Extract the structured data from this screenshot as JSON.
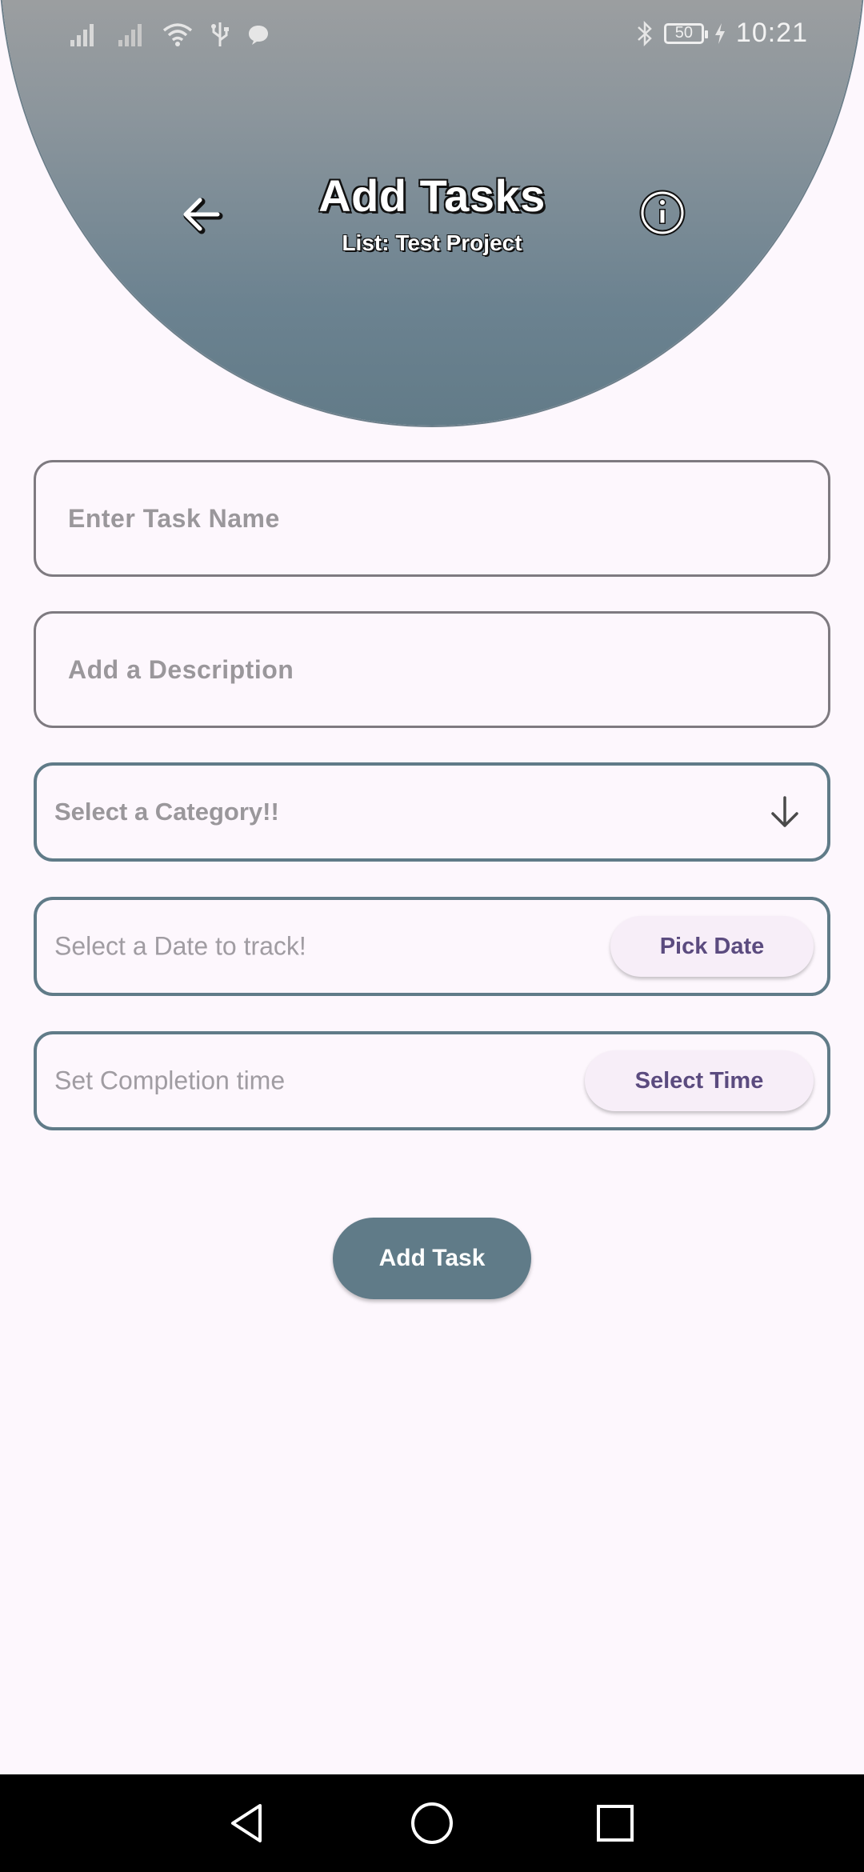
{
  "status_bar": {
    "time": "10:21",
    "battery": "50"
  },
  "header": {
    "title": "Add Tasks",
    "subtitle": "List: Test Project"
  },
  "form": {
    "task_name_placeholder": "Enter Task Name",
    "description_placeholder": "Add a Description",
    "category_label": "Select a Category!!",
    "date_label": "Select a Date to track!",
    "date_button": "Pick Date",
    "time_label": "Set Completion time",
    "time_button": "Select Time",
    "submit_button": "Add Task"
  },
  "colors": {
    "accent": "#607b88",
    "background": "#fdf7fd",
    "pill_text": "#5b4b7f"
  }
}
